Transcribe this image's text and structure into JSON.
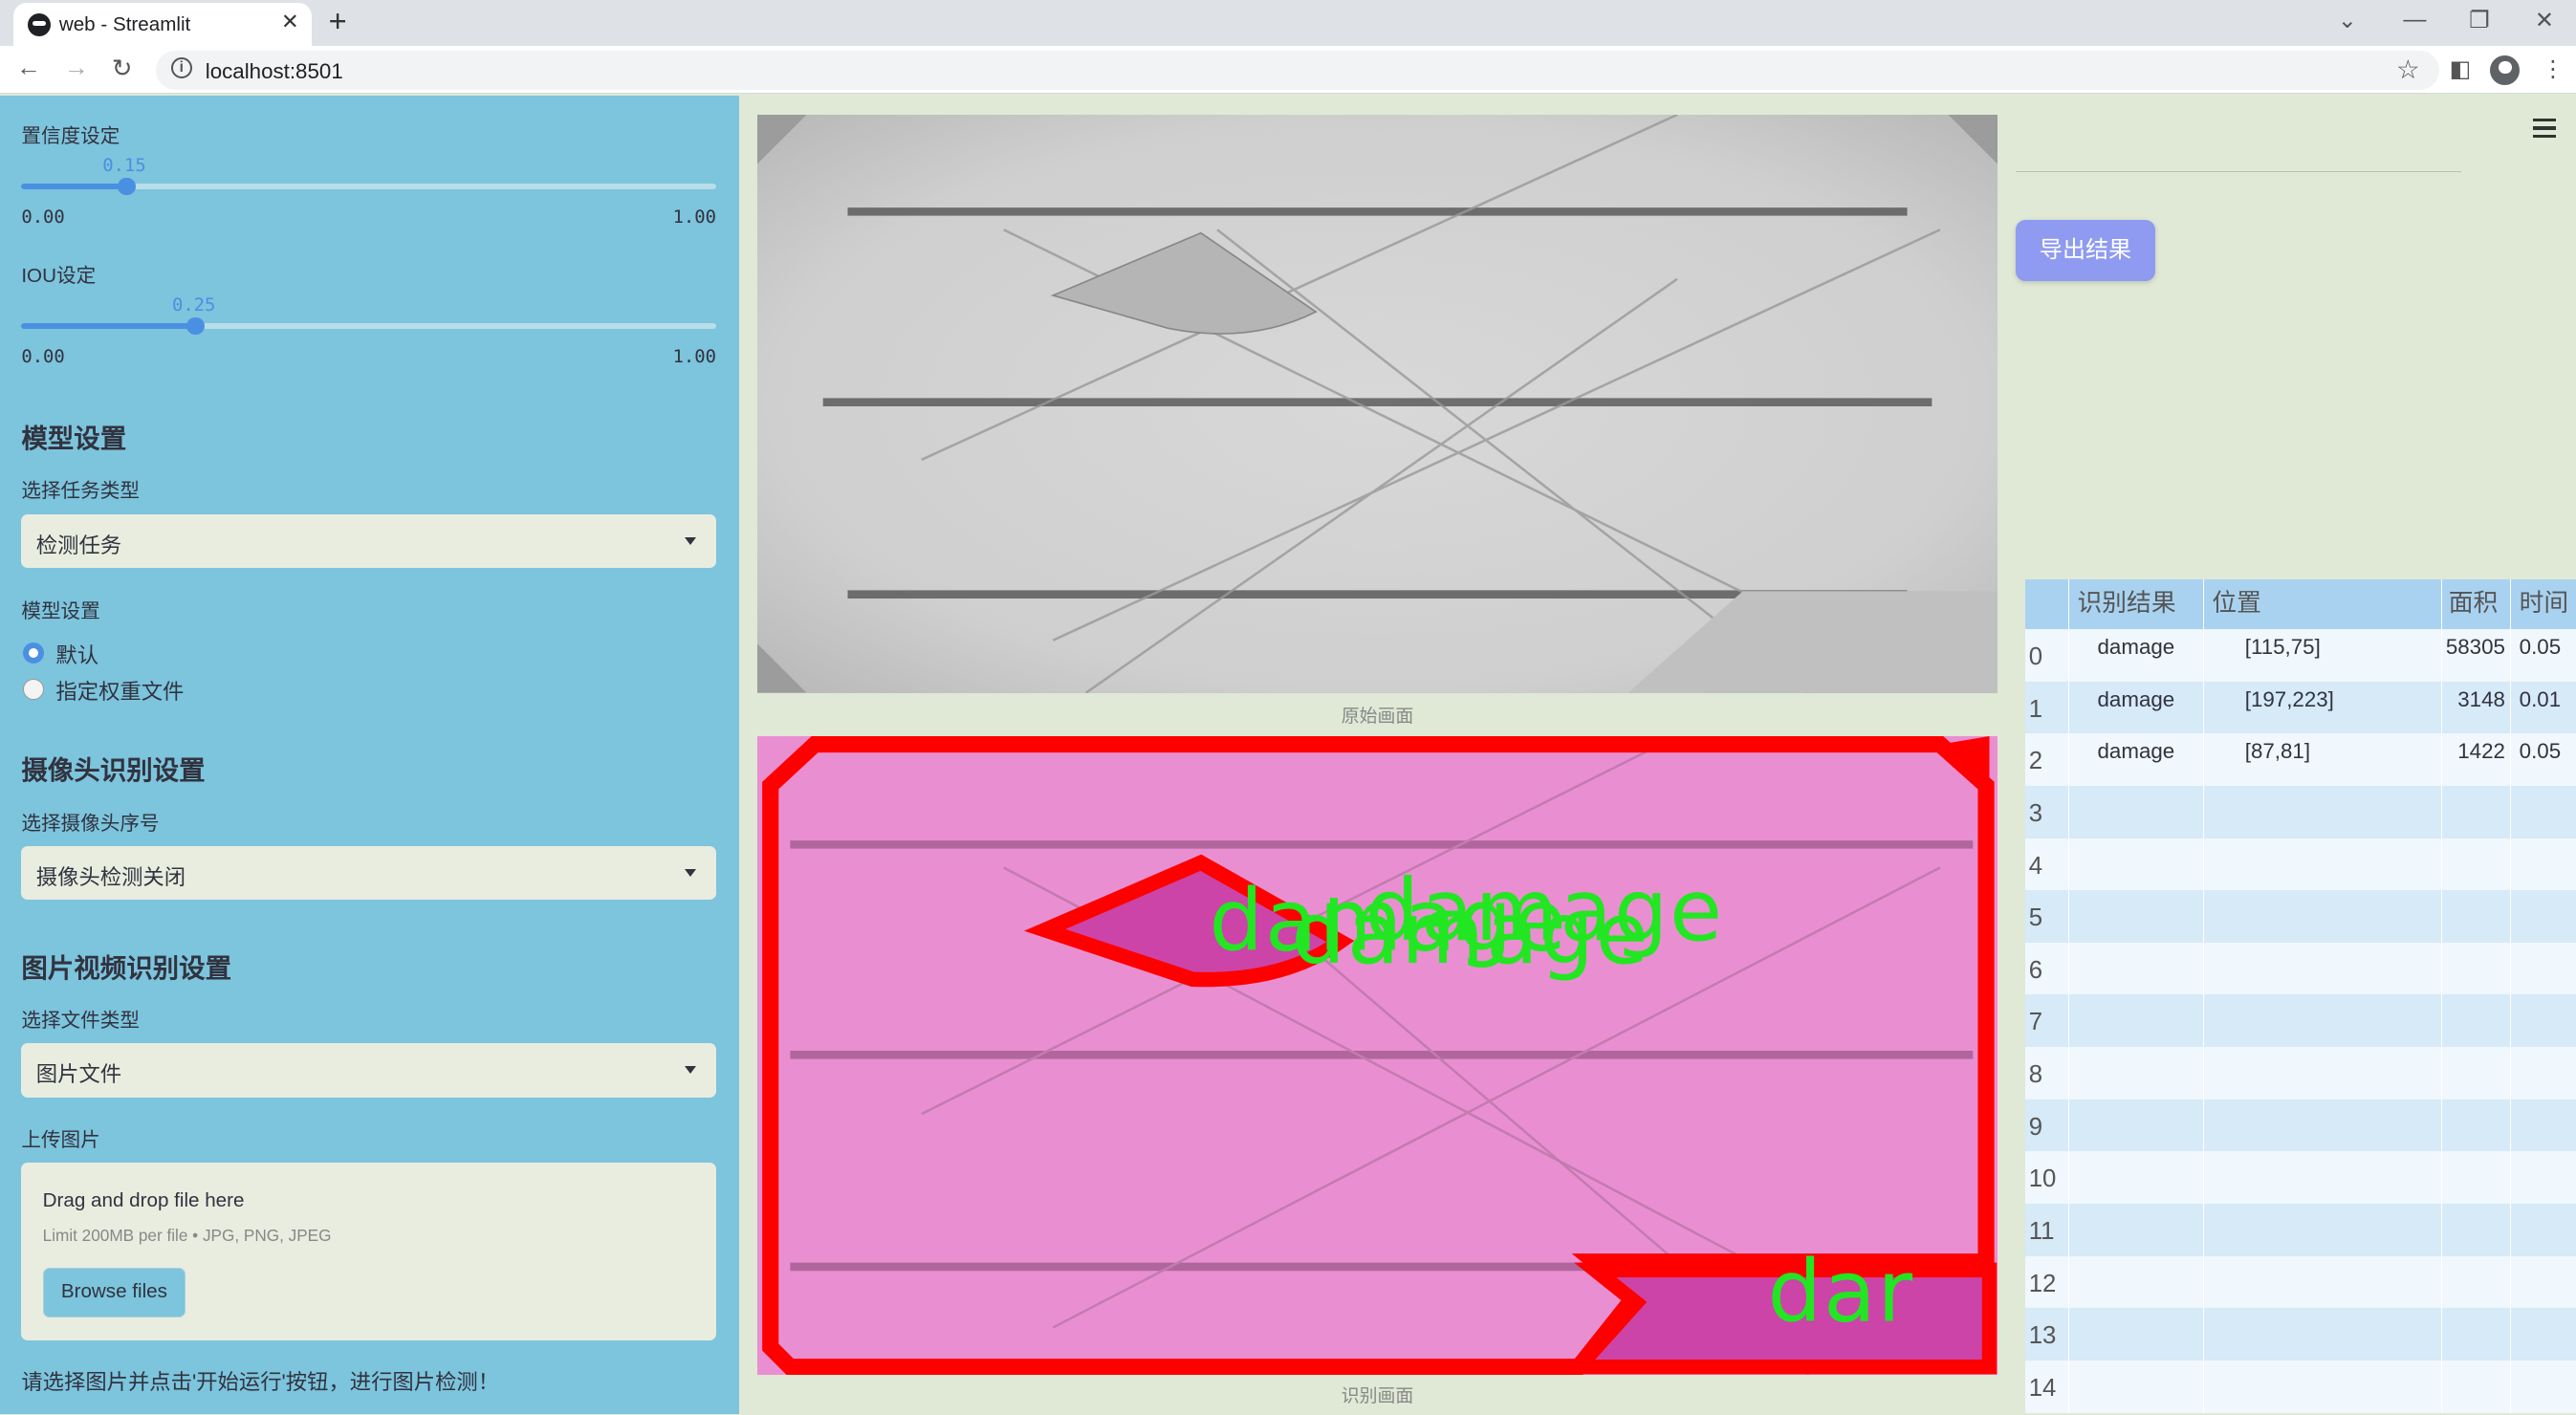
{
  "browser": {
    "tab_title": "web - Streamlit",
    "url": "localhost:8501"
  },
  "sidebar": {
    "confidence": {
      "label": "置信度设定",
      "value": "0.15",
      "value_fraction": 0.15,
      "min": "0.00",
      "max": "1.00"
    },
    "iou": {
      "label": "IOU设定",
      "value": "0.25",
      "value_fraction": 0.25,
      "min": "0.00",
      "max": "1.00"
    },
    "model_section": "模型设置",
    "task_label": "选择任务类型",
    "task_value": "检测任务",
    "model_label": "模型设置",
    "model_options": [
      "默认",
      "指定权重文件"
    ],
    "model_selected": "默认",
    "camera_section": "摄像头识别设置",
    "camera_label": "选择摄像头序号",
    "camera_value": "摄像头检测关闭",
    "file_section": "图片视频识别设置",
    "filetype_label": "选择文件类型",
    "filetype_value": "图片文件",
    "upload_label": "上传图片",
    "upload": {
      "drag_text": "Drag and drop file here",
      "limit_text": "Limit 200MB per file • JPG, PNG, JPEG",
      "browse_label": "Browse files"
    },
    "hint": "请选择图片并点击'开始运行'按钮，进行图片检测！"
  },
  "main": {
    "original_caption": "原始画面",
    "result_caption": "识别画面",
    "detection_labels": [
      "damage",
      "damage",
      "damage",
      "dar"
    ],
    "export_button": "导出结果",
    "colors": {
      "mask": "#e98fd1",
      "outline": "#ff0000",
      "label": "#22e622"
    }
  },
  "table": {
    "columns": [
      "识别结果",
      "位置",
      "面积",
      "时间"
    ],
    "rows": [
      {
        "idx": "0",
        "result": "damage",
        "position": "[115,75]",
        "area": "58305",
        "time": "0.05"
      },
      {
        "idx": "1",
        "result": "damage",
        "position": "[197,223]",
        "area": "3148",
        "time": "0.01"
      },
      {
        "idx": "2",
        "result": "damage",
        "position": "[87,81]",
        "area": "1422",
        "time": "0.05"
      },
      {
        "idx": "3",
        "result": "",
        "position": "",
        "area": "",
        "time": ""
      },
      {
        "idx": "4",
        "result": "",
        "position": "",
        "area": "",
        "time": ""
      },
      {
        "idx": "5",
        "result": "",
        "position": "",
        "area": "",
        "time": ""
      },
      {
        "idx": "6",
        "result": "",
        "position": "",
        "area": "",
        "time": ""
      },
      {
        "idx": "7",
        "result": "",
        "position": "",
        "area": "",
        "time": ""
      },
      {
        "idx": "8",
        "result": "",
        "position": "",
        "area": "",
        "time": ""
      },
      {
        "idx": "9",
        "result": "",
        "position": "",
        "area": "",
        "time": ""
      },
      {
        "idx": "10",
        "result": "",
        "position": "",
        "area": "",
        "time": ""
      },
      {
        "idx": "11",
        "result": "",
        "position": "",
        "area": "",
        "time": ""
      },
      {
        "idx": "12",
        "result": "",
        "position": "",
        "area": "",
        "time": ""
      },
      {
        "idx": "13",
        "result": "",
        "position": "",
        "area": "",
        "time": ""
      },
      {
        "idx": "14",
        "result": "",
        "position": "",
        "area": "",
        "time": ""
      }
    ]
  }
}
